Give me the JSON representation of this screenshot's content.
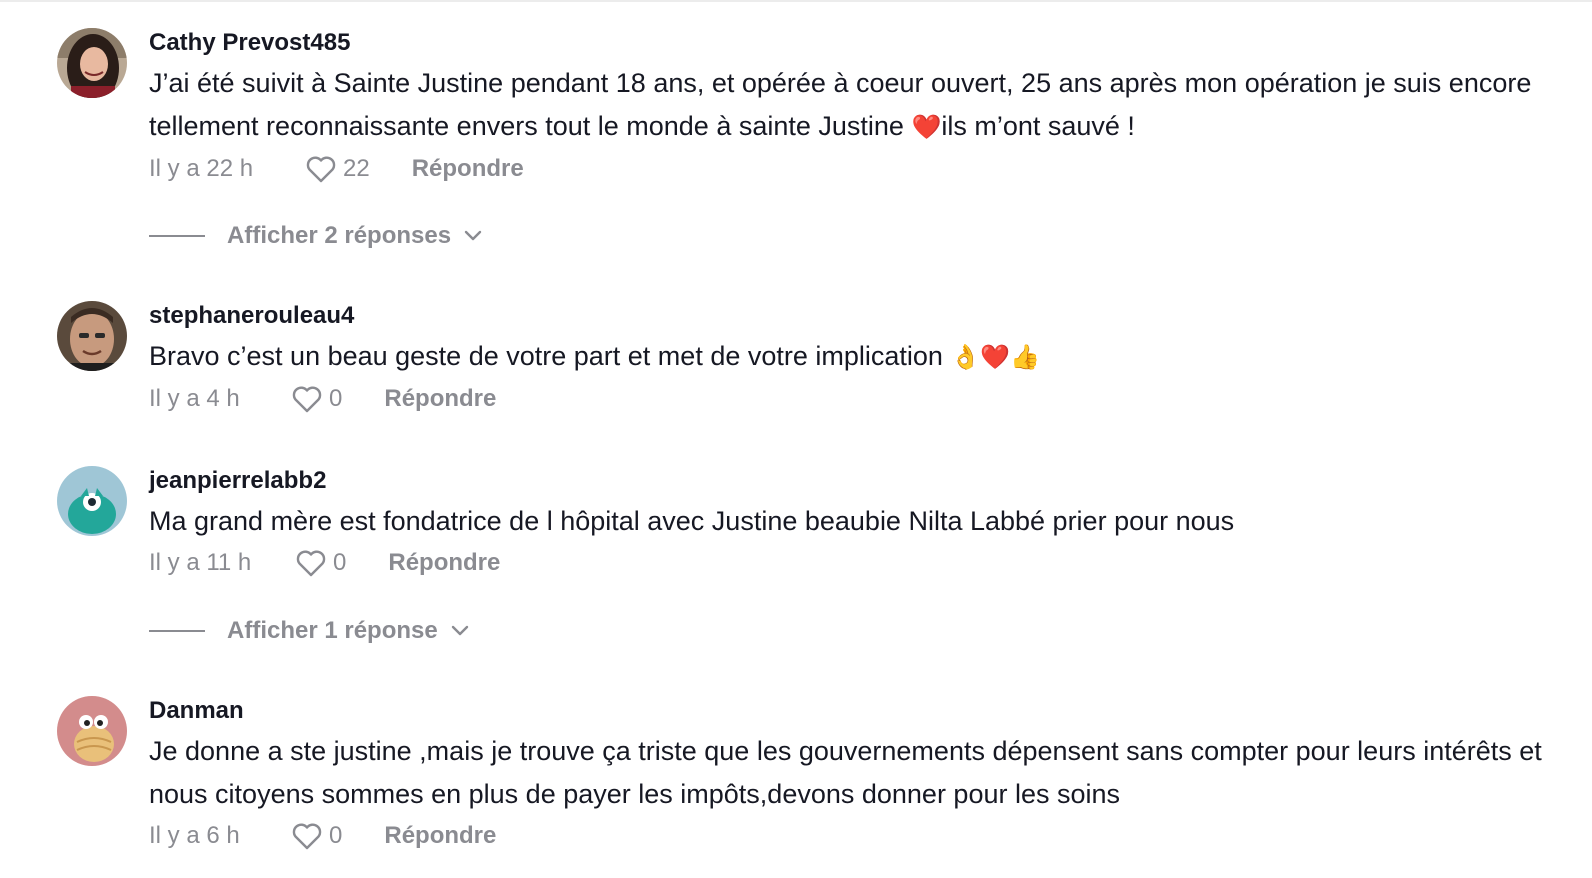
{
  "comments": [
    {
      "username": "Cathy Prevost485",
      "text": "J’ai été suivit à Sainte Justine pendant 18 ans, et opérée à coeur ouvert, 25 ans après mon opération je suis encore tellement reconnaissante envers tout le monde à sainte Justine ",
      "emoji": "❤️",
      "text_after": "ils m’ont sauvé !",
      "time": "Il y a 22 h",
      "likes": "22",
      "reply_label": "Répondre",
      "view_replies": "Afficher 2 réponses"
    },
    {
      "username": "stephanerouleau4",
      "text": "Bravo c’est un beau geste de votre part et met de votre implication ",
      "emoji": "👌❤️👍",
      "time": "Il y a 4 h",
      "likes": "0",
      "reply_label": "Répondre"
    },
    {
      "username": "jeanpierrelabb2",
      "text": "Ma grand mère est fondatrice de l hôpital avec Justine beaubie Nilta Labbé prier pour nous",
      "time": "Il y a 11 h",
      "likes": "0",
      "reply_label": "Répondre",
      "view_replies": "Afficher 1 réponse"
    },
    {
      "username": "Danman",
      "text": "Je donne a ste justine ,mais je trouve ça triste que les gouvernements dépensent sans compter pour leurs intérêts et nous citoyens sommes en plus de payer les impôts,devons donner pour les soins",
      "time": "Il y a 6 h",
      "likes": "0",
      "reply_label": "Répondre"
    }
  ],
  "icons": {
    "like": "heart-outline-icon",
    "expand": "chevron-down-icon"
  },
  "colors": {
    "text": "#161823",
    "muted": "#8a8b91",
    "heart_emoji": "#e0245e"
  }
}
